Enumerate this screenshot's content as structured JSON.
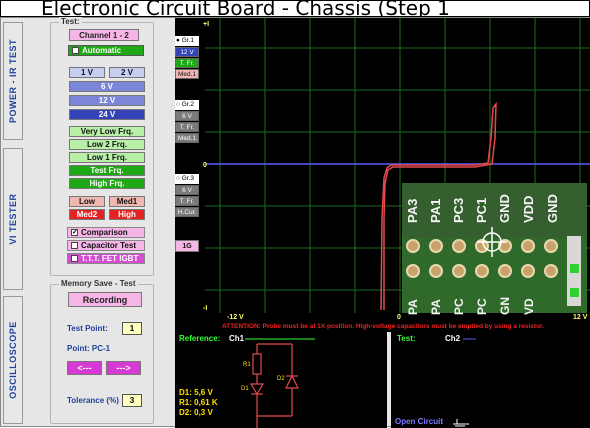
{
  "window_title": "Electronic Circuit Board - Chassis (Step 1",
  "side_tabs": {
    "power": "POWER - IR TEST",
    "vi": "VI TESTER",
    "osc": "OSCILLOSCOPE"
  },
  "test_group": {
    "label": "Test:",
    "channel_button": "Channel 1 - 2",
    "automatic": "Automatic",
    "v1": "1 V",
    "v2": "2 V",
    "v6": "6 V",
    "v12": "12 V",
    "v24": "24 V",
    "freqs": [
      "Very Low Frq.",
      "Low 2 Frq.",
      "Low 1 Frq.",
      "Test Frq.",
      "High Frq."
    ],
    "low": "Low",
    "med1": "Med1",
    "med2": "Med2",
    "high": "High",
    "comparison": "Comparison",
    "comparison_checked": "✓",
    "capacitor": "Capacitor Test",
    "ttt": "T.T.T. FET  IGBT"
  },
  "memory_group": {
    "label": "Memory Save - Test",
    "recording": "Recording",
    "test_point_label": "Test Point:",
    "test_point_value": "1",
    "point_label": "Point:  PC-1",
    "prev": "<---",
    "next": "--->",
    "tolerance_label": "Tolerance (%)",
    "tolerance_value": "3"
  },
  "scope": {
    "top_mark": "+I",
    "bottom_mark": "-I",
    "zero_mark": "0",
    "x_left": "-12 V",
    "x_mid": "0",
    "x_right": "12 V",
    "gr1": {
      "name": "Gr.1",
      "v": "12 V",
      "f": "T. Fr.",
      "m": "Med.1"
    },
    "gr2": {
      "name": "Gr.2",
      "v": "6 V",
      "f": "T. Fr.",
      "m": "Med.1"
    },
    "gr3": {
      "name": "Gr.3",
      "v": "6 V",
      "f": "T. Fr.",
      "m": "H.Cur."
    },
    "one_g": "1G",
    "pins_top": [
      "PA3",
      "PA1",
      "PC3",
      "PC1",
      "GND",
      "VDD",
      "GND"
    ],
    "pins_bottom": [
      "PA",
      "PA",
      "PC",
      "PC",
      "GN",
      "VD"
    ]
  },
  "attention": "ATTENTION: Probe must be at 1X position. High-voltage capacitors must be emptied by using a resistor.",
  "reference_panel": {
    "title": "Reference:",
    "channel": "Ch1",
    "d1": "D1: 5,6 V",
    "r1": "R1: 0,61 K",
    "d2": "D2: 0,3 V",
    "lbl_r1": "R1",
    "lbl_d1": "D1",
    "lbl_d2": "D2"
  },
  "test_panel": {
    "title": "Test:",
    "channel": "Ch2",
    "status": "Open Circuit"
  },
  "colors": {
    "trace": "#e44a4a",
    "axis": "#5a5aff",
    "grid": "#1f6b1f",
    "blue_text": "#1f3f99"
  }
}
